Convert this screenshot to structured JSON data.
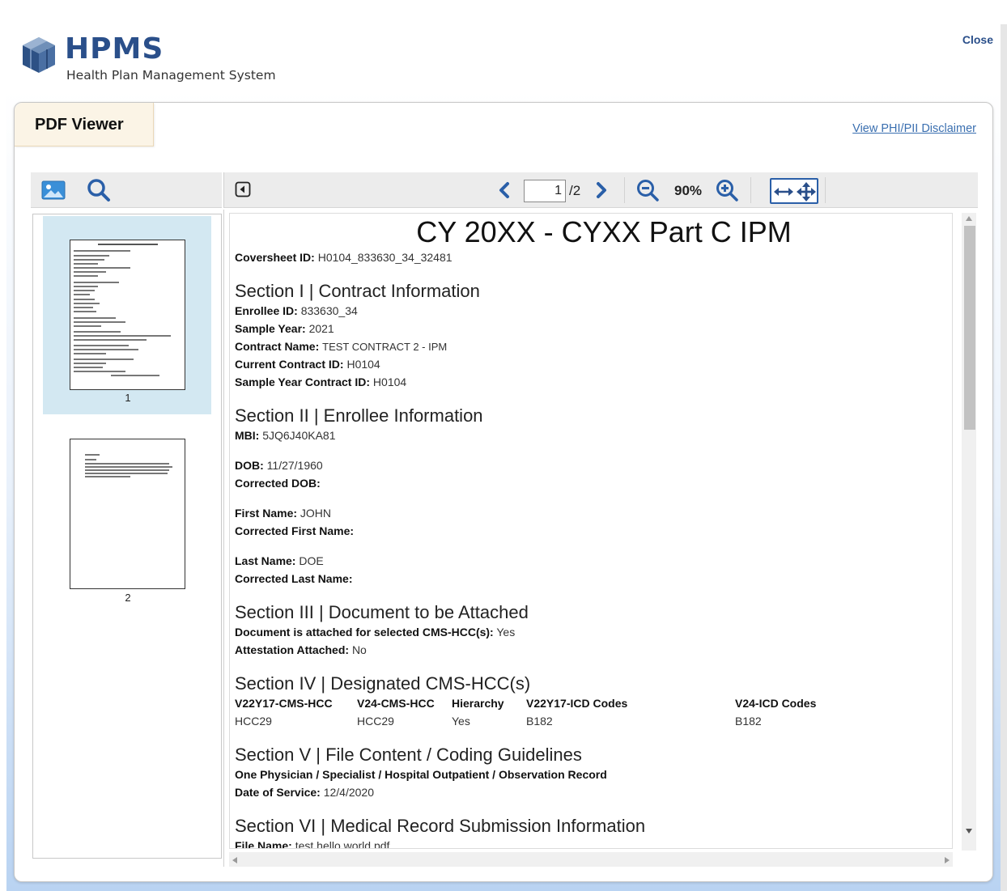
{
  "brand": {
    "name": "HPMS",
    "subtitle": "Health Plan Management System",
    "color": "#2a4f8a"
  },
  "header": {
    "close_label": "Close"
  },
  "panel": {
    "tab_label": "PDF Viewer",
    "disclaimer_link": "View PHI/PII Disclaimer"
  },
  "toolbar": {
    "thumbnails_icon": "image-icon",
    "search_icon": "search-icon",
    "sidebar_toggle_icon": "sidebar-toggle-icon",
    "current_page": "1",
    "page_total": "/2",
    "zoom": "90%",
    "accent": "#2a5fa8"
  },
  "thumbnails": {
    "items": [
      {
        "label": "1",
        "selected": true
      },
      {
        "label": "2",
        "selected": false
      }
    ]
  },
  "document": {
    "title": "CY 20XX - CYXX Part C IPM",
    "coversheet": {
      "label": "Coversheet ID:",
      "value": "H0104_833630_34_32481"
    },
    "s1": {
      "heading": "Section I | Contract Information",
      "fields": [
        {
          "label": "Enrollee ID:",
          "value": "833630_34"
        },
        {
          "label": "Sample Year:",
          "value": "2021"
        },
        {
          "label": "Contract Name:",
          "value": "TEST CONTRACT 2 - IPM"
        },
        {
          "label": "Current Contract ID:",
          "value": "H0104"
        },
        {
          "label": "Sample Year Contract ID:",
          "value": "H0104"
        }
      ]
    },
    "s2": {
      "heading": "Section II | Enrollee Information",
      "fields": [
        {
          "label": "MBI:",
          "value": "5JQ6J40KA81"
        },
        {
          "label": "DOB:",
          "value": "11/27/1960"
        },
        {
          "label": "Corrected DOB:",
          "value": ""
        },
        {
          "label": "First Name:",
          "value": "JOHN"
        },
        {
          "label": "Corrected First Name:",
          "value": ""
        },
        {
          "label": "Last Name:",
          "value": "DOE"
        },
        {
          "label": "Corrected Last Name:",
          "value": ""
        }
      ]
    },
    "s3": {
      "heading": "Section III | Document to be Attached",
      "fields": [
        {
          "label": "Document is attached for selected CMS-HCC(s):",
          "value": "Yes"
        },
        {
          "label": "Attestation Attached:",
          "value": "No"
        }
      ]
    },
    "s4": {
      "heading": "Section IV | Designated CMS-HCC(s)",
      "columns": [
        "V22Y17-CMS-HCC",
        "V24-CMS-HCC",
        "Hierarchy",
        "V22Y17-ICD Codes",
        "V24-ICD Codes"
      ],
      "row": [
        "HCC29",
        "HCC29",
        "Yes",
        "B182",
        "B182"
      ]
    },
    "s5": {
      "heading": "Section V | File Content / Coding Guidelines",
      "record_type": "One Physician / Specialist / Hospital Outpatient / Observation Record",
      "fields": [
        {
          "label": "Date of Service:",
          "value": "12/4/2020"
        }
      ]
    },
    "s6": {
      "heading": "Section VI | Medical Record Submission Information",
      "fields": [
        {
          "label": "File Name:",
          "value": "test hello world.pdf"
        }
      ]
    }
  }
}
